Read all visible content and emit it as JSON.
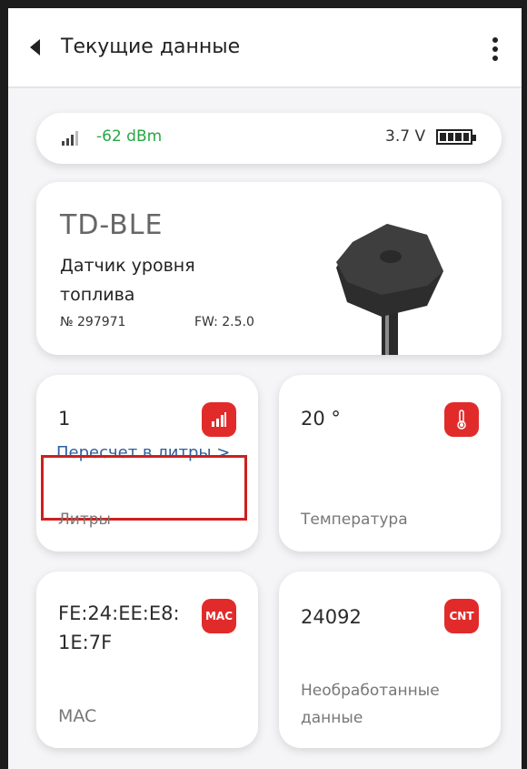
{
  "header": {
    "title": "Текущие данные"
  },
  "status": {
    "rssi": "-62 dBm",
    "voltage": "3.7 V"
  },
  "device": {
    "model": "TD-BLE",
    "description": "Датчик уровня топлива",
    "serial": "№ 297971",
    "firmware": "FW: 2.5.0"
  },
  "tiles": {
    "liters": {
      "value": "1",
      "link": "Пересчет в литры >",
      "label": "Литры",
      "icon": "signal-bars-icon"
    },
    "temperature": {
      "value": "20 °",
      "label": "Температура",
      "icon": "thermometer-icon"
    },
    "mac": {
      "value": "FE:24:EE:E8:\n1E:7F",
      "label": "MAC",
      "badge": "MAC"
    },
    "raw": {
      "value": "24092",
      "label": "Необработанные данные",
      "badge": "CNT"
    }
  },
  "colors": {
    "accent": "#e12b2b",
    "rssi": "#27a844",
    "link": "#2f5f9e",
    "highlight": "#cf1f1f"
  }
}
